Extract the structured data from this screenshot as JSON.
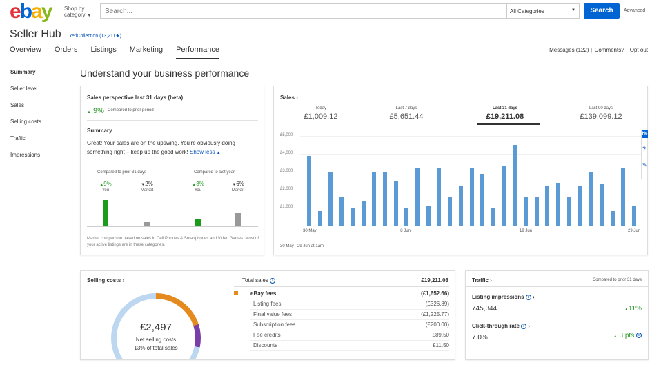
{
  "header": {
    "logo": [
      "e",
      "b",
      "a",
      "y"
    ],
    "shop_by": "Shop by",
    "category": "category",
    "search_placeholder": "Search...",
    "category_select": "All Categories",
    "search_button": "Search",
    "advanced": "Advanced"
  },
  "hub": {
    "title": "Seller Hub",
    "store": "YetiCollection (13,211★)"
  },
  "tabs": [
    "Overview",
    "Orders",
    "Listings",
    "Marketing",
    "Performance"
  ],
  "active_tab": "Performance",
  "top_links": {
    "messages": "Messages (122)",
    "comments": "Comments?",
    "opt_out": "Opt out",
    "separator": "|"
  },
  "left_nav": [
    "Summary",
    "Seller level",
    "Sales",
    "Selling costs",
    "Traffic",
    "Impressions"
  ],
  "page_heading": "Understand your business performance",
  "sales_perspective": {
    "title": "Sales perspective last 31 days (beta)",
    "change": "9%",
    "compared": "Compared to prior period",
    "summary_title": "Summary",
    "summary_text": "Great! Your sales are on the upswing. You're obviously doing something right – keep up the good work!",
    "show_less": "Show less",
    "group1_title": "Compared to prior 31 days",
    "group2_title": "Compared to last year",
    "stats": [
      {
        "value": "9%",
        "label": "You",
        "dir": "up",
        "level": 0.9,
        "color": "#1a9b1a"
      },
      {
        "value": "2%",
        "label": "Market",
        "dir": "down",
        "level": 0.15,
        "color": "#999999"
      },
      {
        "value": "3%",
        "label": "You",
        "dir": "up",
        "level": 0.25,
        "color": "#1a9b1a"
      },
      {
        "value": "6%",
        "label": "Market",
        "dir": "down",
        "level": 0.45,
        "color": "#999999"
      }
    ],
    "note": "Market comparison based on sales in Cell Phones & Smartphones and Video Games. Most of your active listings are in these categories."
  },
  "sales": {
    "title": "Sales",
    "periods": [
      {
        "label": "Today",
        "value": "£1,009.12"
      },
      {
        "label": "Last 7 days",
        "value": "£5,651.44"
      },
      {
        "label": "Last 31 days",
        "value": "£19,211.08"
      },
      {
        "label": "Last 90 days",
        "value": "£139,099.12"
      }
    ],
    "active_period": "Last 31 days",
    "date_range": "30 May - 29 Jun at 1am",
    "bar_color": "#5b9bd5"
  },
  "chart_data": {
    "type": "bar",
    "title": "Sales",
    "ylim": [
      0,
      5000
    ],
    "yticks": [
      "£1,000",
      "£2,000",
      "£3,000",
      "£4,000",
      "£5,000"
    ],
    "xticks": [
      "30 May",
      "8 Jun",
      "19 Jun",
      "29 Jun"
    ],
    "values": [
      3900,
      800,
      3000,
      1600,
      1000,
      1400,
      3000,
      3000,
      2500,
      1000,
      3200,
      1100,
      3200,
      1600,
      2200,
      3200,
      2900,
      1000,
      3300,
      4500,
      1600,
      1600,
      2200,
      2400,
      1600,
      2200,
      3000,
      2300,
      800,
      3200,
      1100
    ]
  },
  "selling_costs": {
    "title": "Selling costs",
    "amount": "£2,497",
    "amount_label": "Net selling costs",
    "amount_pct": "13% of total sales",
    "total_label": "Total sales",
    "total_value": "£19,211.08",
    "rows": [
      {
        "label": "eBay fees",
        "value": "(£1,652.66)",
        "main": true
      },
      {
        "label": "Listing fees",
        "value": "(£326.89)",
        "main": false
      },
      {
        "label": "Final value fees",
        "value": "(£1,225.77)",
        "main": false
      },
      {
        "label": "Subscription fees",
        "value": "(£200.00)",
        "main": false
      },
      {
        "label": "Fee credits",
        "value": "£89.50",
        "main": false
      },
      {
        "label": "Discounts",
        "value": "£11.50",
        "main": false
      }
    ],
    "ring_colors": [
      "#e58a1f",
      "#7a3ea8",
      "#bcd7ef"
    ]
  },
  "traffic": {
    "title": "Traffic",
    "compared": "Compared to prior 31 days",
    "metrics": [
      {
        "label": "Listing impressions",
        "value": "745,344",
        "change": "11%"
      },
      {
        "label": "Click-through rate",
        "value": "7.0%",
        "change": "3 pts"
      }
    ]
  },
  "help": {
    "tab": "He",
    "question": "?",
    "feedback": "✎"
  }
}
